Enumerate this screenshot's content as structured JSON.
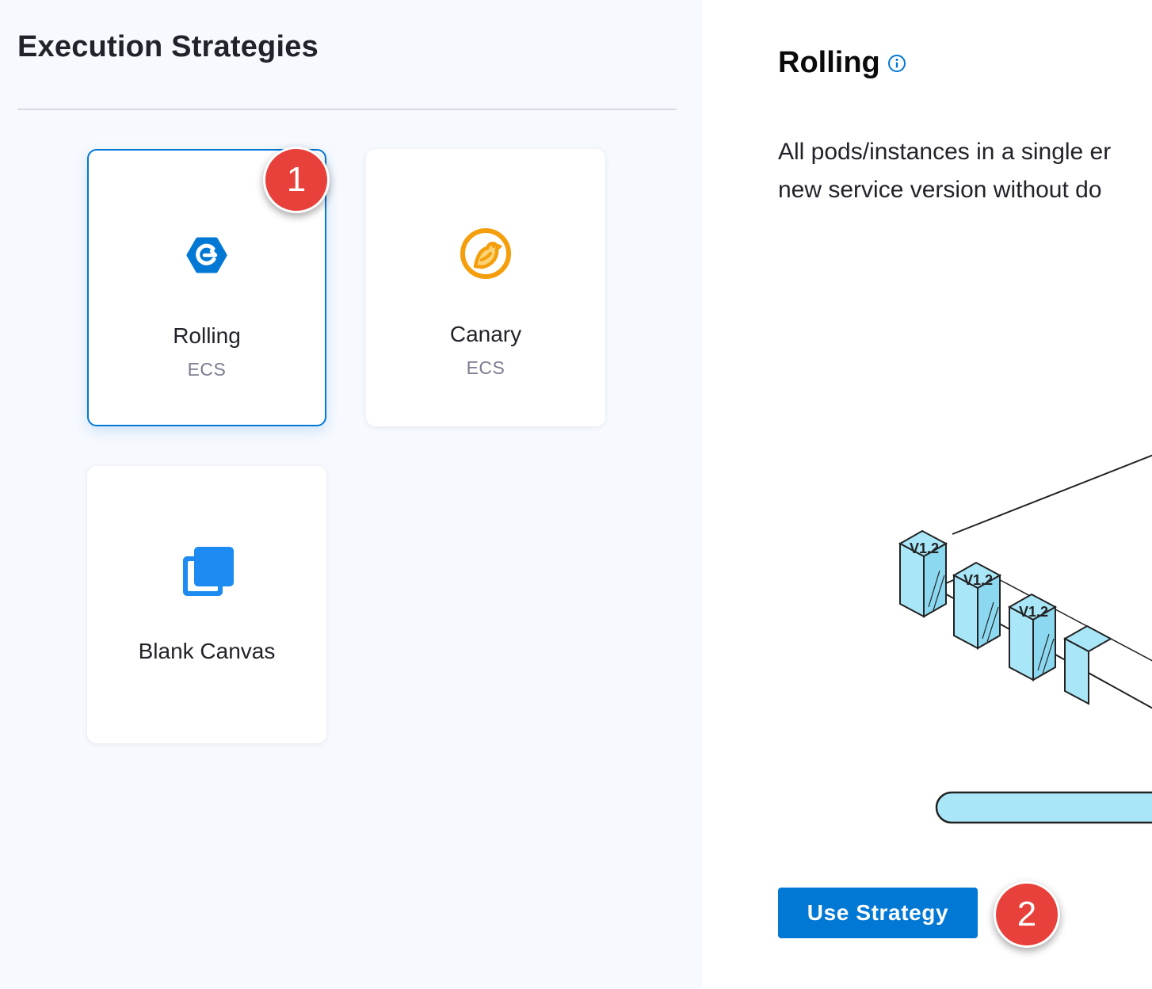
{
  "left_panel": {
    "title": "Execution Strategies"
  },
  "strategies": [
    {
      "label": "Rolling",
      "subtitle": "ECS",
      "icon": "rolling-hexagon-icon",
      "icon_color": "#0278d5",
      "selected": true
    },
    {
      "label": "Canary",
      "subtitle": "ECS",
      "icon": "canary-bird-icon",
      "icon_color": "#f59e0b",
      "selected": false
    },
    {
      "label": "Blank Canvas",
      "subtitle": "",
      "icon": "blank-canvas-icon",
      "icon_color": "#1d8bf1",
      "selected": false
    }
  ],
  "step_badges": {
    "first": "1",
    "second": "2",
    "color": "#e8403a"
  },
  "detail": {
    "title": "Rolling",
    "info_icon": "info-icon",
    "description_line1": "All pods/instances in a single er",
    "description_line2": "new service version without do",
    "diagram": {
      "box_label": "V1.2",
      "box_color": "#a8e6f8"
    },
    "button_label": "Use Strategy"
  },
  "colors": {
    "accent": "#0278d5",
    "panel_bg": "#f6f9fe"
  }
}
